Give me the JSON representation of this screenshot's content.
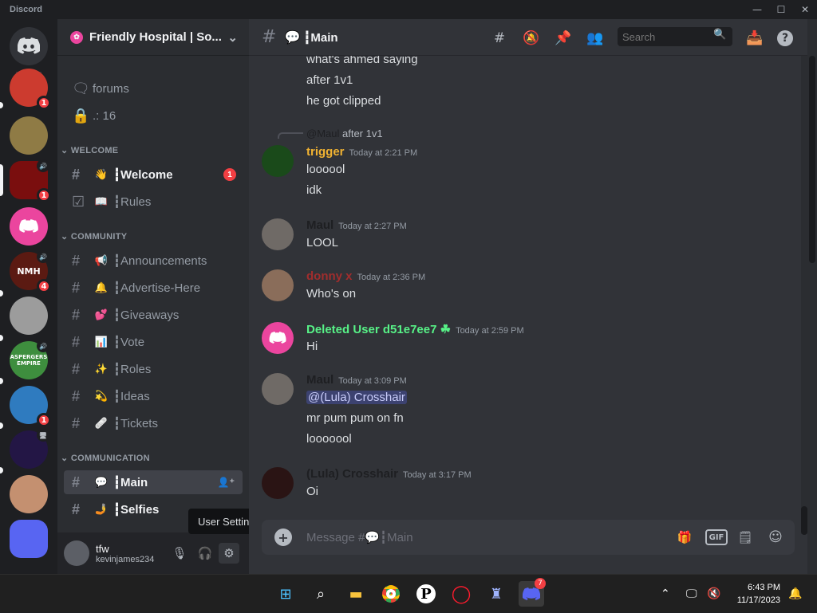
{
  "window": {
    "title": "Discord",
    "minimize": "—",
    "maximize": "☐",
    "close": "✕"
  },
  "guilds": [
    {
      "label": "",
      "color": "#cc3b2f",
      "badge": "1"
    },
    {
      "label": "",
      "color": "#8f7b45",
      "badge": ""
    },
    {
      "label": "",
      "color": "#7a0e0e",
      "badge": "1"
    },
    {
      "label": "",
      "color": "#eb459e",
      "badge": ""
    },
    {
      "label": "NMH",
      "color": "#5b1a12",
      "badge": "4"
    },
    {
      "label": "",
      "color": "#9c9c9c",
      "badge": ""
    },
    {
      "label": "ASPERGERS EMPIRE",
      "color": "#3e8e3e",
      "badge": ""
    },
    {
      "label": "",
      "color": "#2f7bbf",
      "badge": "1"
    },
    {
      "label": "",
      "color": "#231645",
      "badge": ""
    },
    {
      "label": "",
      "color": "#c49070",
      "badge": ""
    },
    {
      "label": "",
      "color": "#5865f2",
      "badge": ""
    }
  ],
  "server": {
    "name": "Friendly Hospital | So..."
  },
  "channels": {
    "forums": "forums",
    "count_channel": ".: 16",
    "categories": {
      "welcome": "WELCOME",
      "community": "COMMUNITY",
      "communication": "COMMUNICATION"
    },
    "welcome": [
      {
        "emoji": "👋",
        "name": "┇Welcome",
        "badge": "1"
      },
      {
        "emoji": "📖",
        "name": "┇Rules"
      }
    ],
    "community": [
      {
        "emoji": "📢",
        "name": "┇Announcements"
      },
      {
        "emoji": "🔔",
        "name": "┇Advertise-Here"
      },
      {
        "emoji": "💕",
        "name": "┇Giveaways"
      },
      {
        "emoji": "📊",
        "name": "┇Vote"
      },
      {
        "emoji": "✨",
        "name": "┇Roles"
      },
      {
        "emoji": "💫",
        "name": "┇Ideas"
      },
      {
        "emoji": "🩹",
        "name": "┇Tickets"
      }
    ],
    "communication": [
      {
        "emoji": "💬",
        "name": "┇Main"
      },
      {
        "emoji": "🤳",
        "name": "┇Selfies"
      }
    ]
  },
  "user": {
    "name": "tfw",
    "tag": "kevinjames234"
  },
  "tooltip": "User Settings",
  "topbar": {
    "channel_emoji": "💬",
    "channel_name": "┇Main",
    "search_placeholder": "Search"
  },
  "messages": {
    "top_lines": [
      "what's ahmed saying",
      "after 1v1",
      "he got clipped"
    ],
    "reply": {
      "author": "@Maul",
      "text": "after 1v1"
    },
    "groups": [
      {
        "author": "trigger",
        "color": "#f0b232",
        "time": "Today at 2:21 PM",
        "lines": [
          "loooool",
          "idk"
        ]
      },
      {
        "author": "Maul",
        "color": "#1e1f22",
        "time": "Today at 2:27 PM",
        "lines": [
          "LOOL"
        ]
      },
      {
        "author": "donny x",
        "color": "#a12d2d",
        "time": "Today at 2:36 PM",
        "lines": [
          "Who's on"
        ]
      },
      {
        "author": "Deleted User d51e7ee7",
        "color": "#57f287",
        "time": "Today at 2:59 PM",
        "lines": [
          "Hi"
        ]
      },
      {
        "author": "Maul",
        "color": "#1e1f22",
        "time": "Today at 3:09 PM",
        "mention": "@(Lula) Crosshair",
        "lines": [
          "mr pum pum on fn",
          "looooool"
        ]
      },
      {
        "author": "(Lula) Crosshair",
        "color": "#1e1f22",
        "time": "Today at 3:17 PM",
        "lines": [
          "Oi"
        ]
      }
    ]
  },
  "composer": {
    "placeholder": "Message #💬┇Main",
    "gif": "GIF"
  },
  "taskbar": {
    "time": "6:43 PM",
    "date": "11/17/2023",
    "discord_badge": "7"
  }
}
